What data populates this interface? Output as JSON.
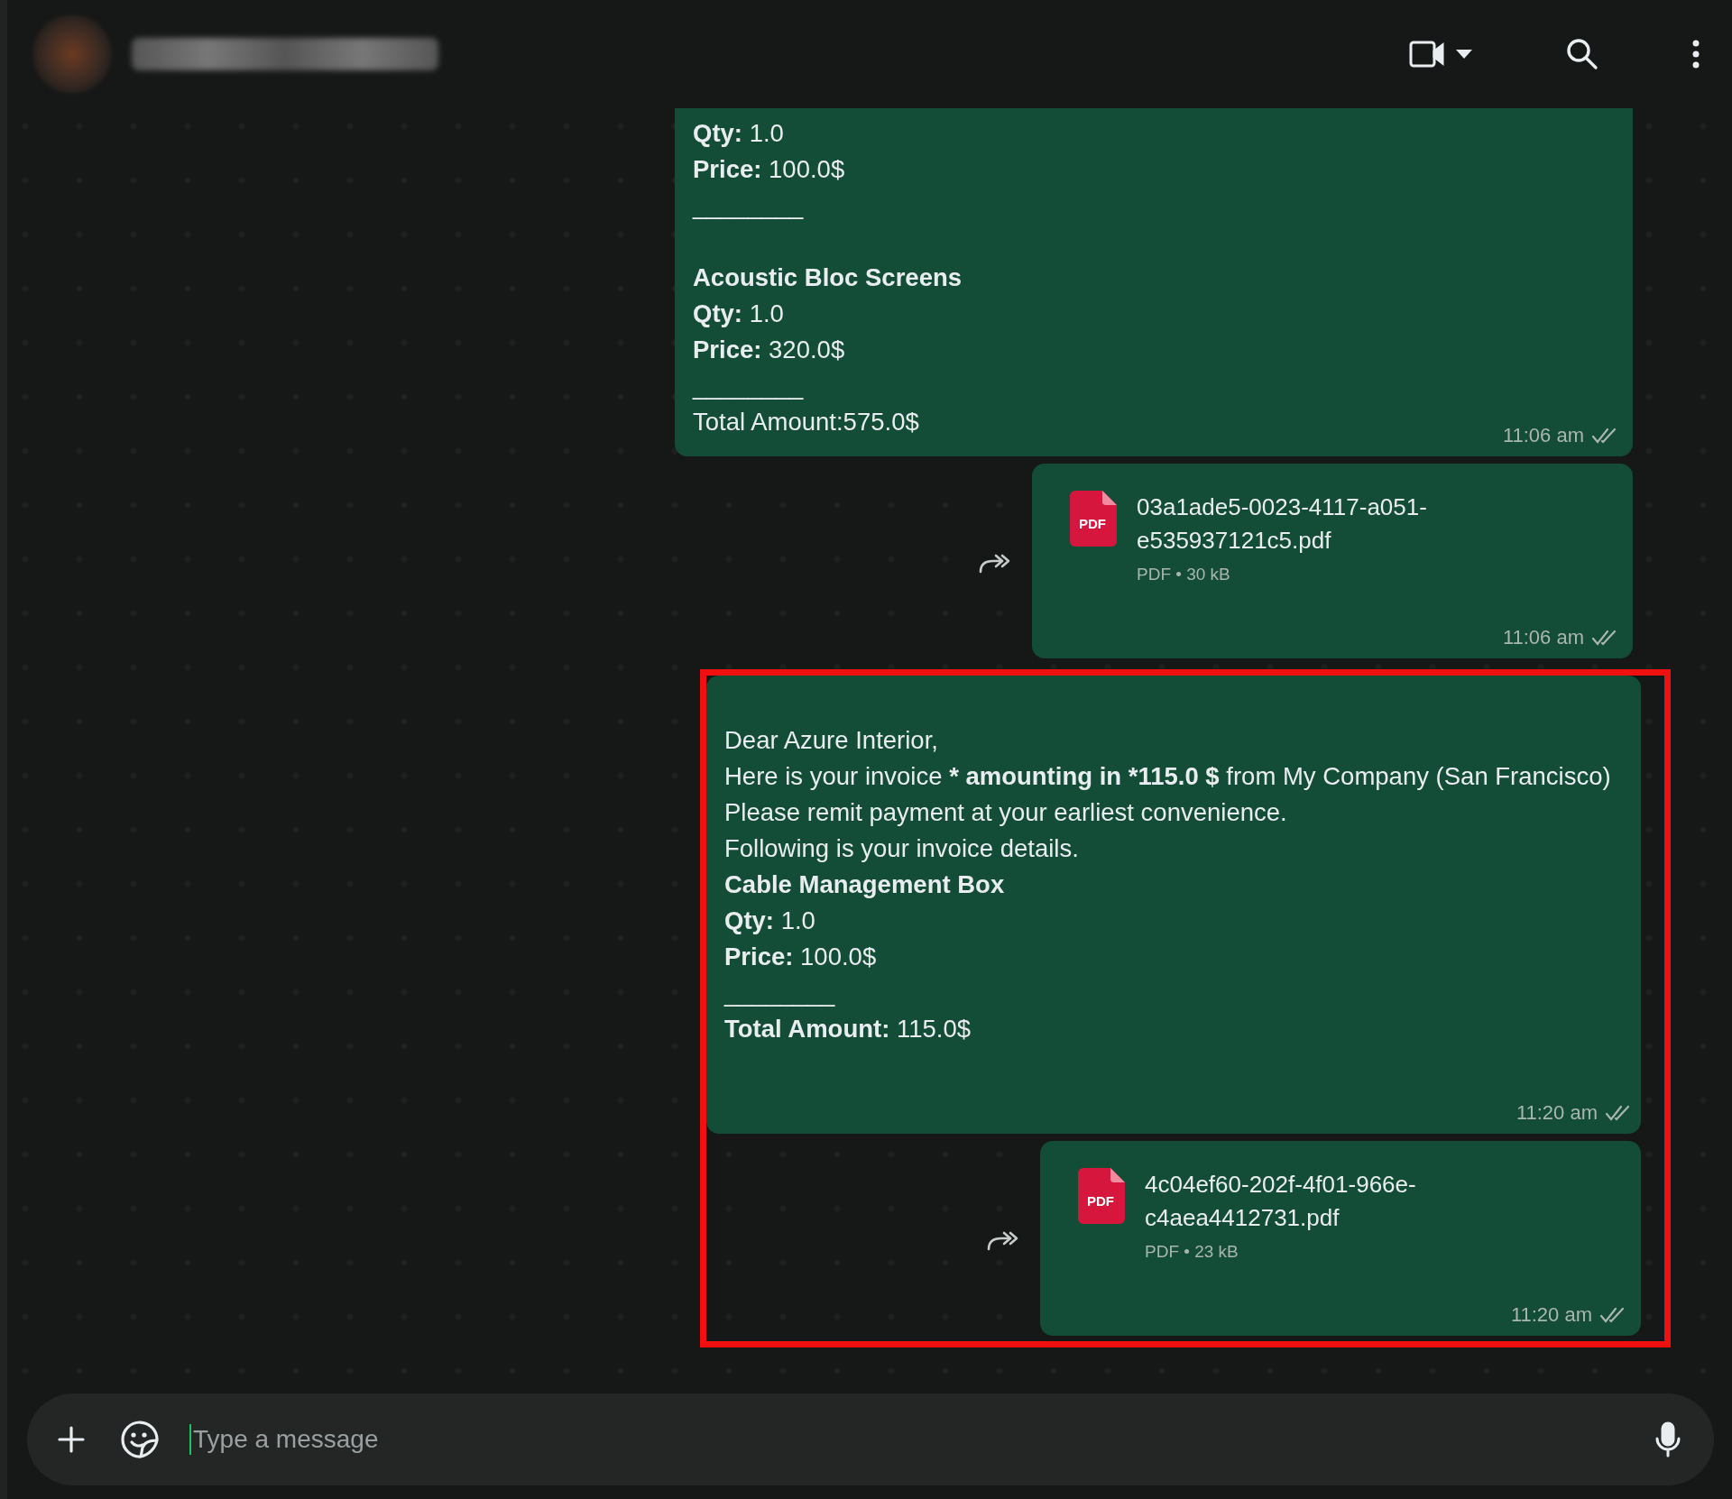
{
  "composer": {
    "placeholder": "Type a message"
  },
  "messages": [
    {
      "kind": "text",
      "time": "11:06 am",
      "lines": [
        {
          "kind": "text",
          "parts": [
            {
              "text": "Qty:",
              "bold": true
            },
            {
              "text": " 1.0",
              "bold": false
            }
          ]
        },
        {
          "kind": "text",
          "parts": [
            {
              "text": "Price:",
              "bold": true
            },
            {
              "text": " 100.0$",
              "bold": false
            }
          ]
        },
        {
          "kind": "text",
          "parts": [
            {
              "text": "________",
              "bold": false
            }
          ]
        },
        {
          "kind": "gap"
        },
        {
          "kind": "text",
          "parts": [
            {
              "text": "Acoustic Bloc Screens",
              "bold": true
            }
          ]
        },
        {
          "kind": "text",
          "parts": [
            {
              "text": "Qty:",
              "bold": true
            },
            {
              "text": " 1.0",
              "bold": false
            }
          ]
        },
        {
          "kind": "text",
          "parts": [
            {
              "text": "Price:",
              "bold": true
            },
            {
              "text": " 320.0$",
              "bold": false
            }
          ]
        },
        {
          "kind": "text",
          "parts": [
            {
              "text": "________",
              "bold": false
            }
          ]
        },
        {
          "kind": "text",
          "parts": [
            {
              "text": "Total Amount:575.0$",
              "bold": false
            }
          ]
        }
      ]
    },
    {
      "kind": "file",
      "time": "11:06 am",
      "file_name": "03a1ade5-0023-4117-a051-e535937121c5.pdf",
      "file_type": "PDF",
      "file_meta": "PDF • 30 kB"
    }
  ],
  "highlighted_messages": [
    {
      "kind": "text",
      "time": "11:20 am",
      "lines": [
        {
          "kind": "text",
          "parts": [
            {
              "text": "Dear Azure Interior,",
              "bold": false
            }
          ]
        },
        {
          "kind": "text",
          "parts": [
            {
              "text": "Here is your invoice ",
              "bold": false
            },
            {
              "text": "* amounting in *115.0 $",
              "bold": true
            },
            {
              "text": " from My Company (San Francisco)",
              "bold": false
            }
          ]
        },
        {
          "kind": "text",
          "parts": [
            {
              "text": "Please remit payment at your earliest convenience.",
              "bold": false
            }
          ]
        },
        {
          "kind": "text",
          "parts": [
            {
              "text": "Following is your invoice details.",
              "bold": false
            }
          ]
        },
        {
          "kind": "text",
          "parts": [
            {
              "text": "Cable Management Box",
              "bold": true
            }
          ]
        },
        {
          "kind": "text",
          "parts": [
            {
              "text": "Qty:",
              "bold": true
            },
            {
              "text": " 1.0",
              "bold": false
            }
          ]
        },
        {
          "kind": "text",
          "parts": [
            {
              "text": "Price:",
              "bold": true
            },
            {
              "text": " 100.0$",
              "bold": false
            }
          ]
        },
        {
          "kind": "text",
          "parts": [
            {
              "text": "________",
              "bold": false
            }
          ]
        },
        {
          "kind": "text",
          "parts": [
            {
              "text": "Total Amount:",
              "bold": true
            },
            {
              "text": " 115.0$",
              "bold": false
            }
          ]
        }
      ]
    },
    {
      "kind": "file",
      "time": "11:20 am",
      "file_name": "4c04ef60-202f-4f01-966e-c4aea4412731.pdf",
      "file_type": "PDF",
      "file_meta": "PDF • 23 kB"
    }
  ]
}
